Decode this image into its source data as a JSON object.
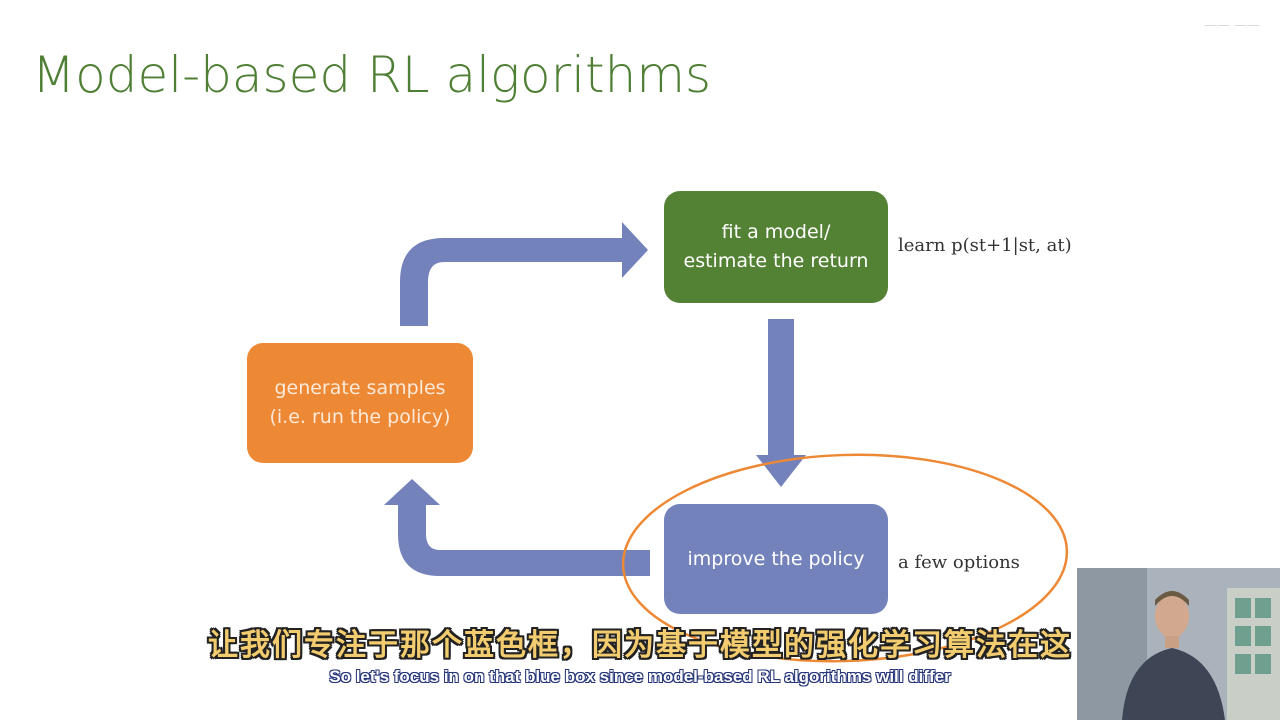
{
  "slide": {
    "title": "Model-based RL algorithms",
    "watermark": "—— ——"
  },
  "diagram": {
    "boxes": {
      "fit_model": "fit a model/\nestimate the return",
      "generate_samples": "generate samples\n(i.e. run the policy)",
      "improve_policy": "improve the policy"
    },
    "annotations": {
      "learn_prefix": "learn",
      "learn_formula": "p(st+1|st, at)",
      "few_options": "a few options"
    },
    "colors": {
      "green": "#548235",
      "orange": "#ed8935",
      "blue": "#7382bb",
      "arrow": "#7382bb",
      "highlight": "#ed8935"
    }
  },
  "subtitles": {
    "chinese": "让我们专注于那个蓝色框，因为基于模型的强化学习算法在这",
    "english": "So let's focus in on that blue box since model-based RL algorithms will differ"
  },
  "webcam": {
    "icon": "presenter-video-thumbnail"
  }
}
